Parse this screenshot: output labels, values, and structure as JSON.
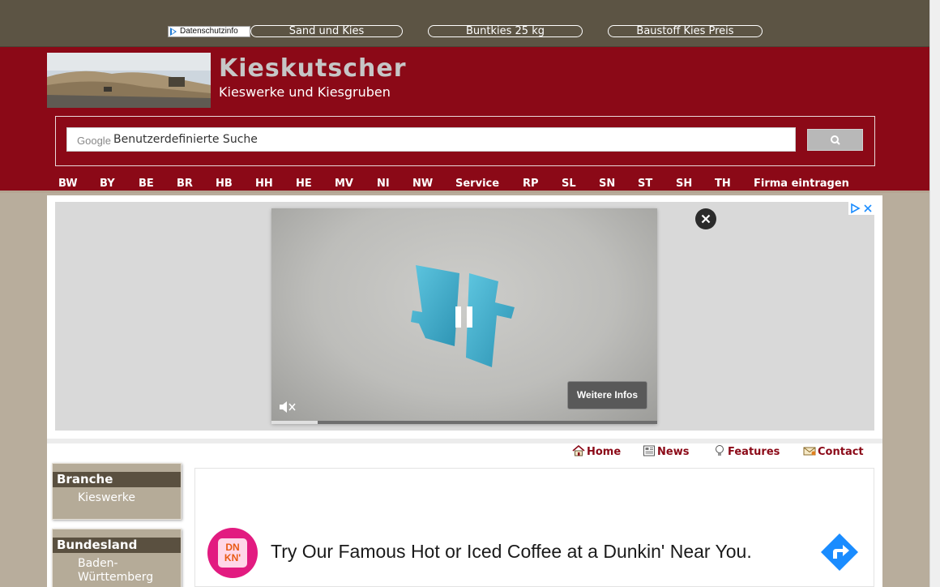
{
  "topbar": {
    "privacy_label": "Datenschutzinfo",
    "links": [
      "Sand und Kies",
      "Buntkies 25 kg",
      "Baustoff Kies Preis"
    ]
  },
  "header": {
    "title": "Kieskutscher",
    "subtitle": "Kieswerke und Kiesgruben"
  },
  "search": {
    "brand": "Google",
    "placeholder": "Benutzerdefinierte Suche"
  },
  "nav": [
    "BW",
    "BY",
    "BE",
    "BR",
    "HB",
    "HH",
    "HE",
    "MV",
    "NI",
    "NW",
    "Service",
    "RP",
    "SL",
    "SN",
    "ST",
    "SH",
    "TH",
    "Firma eintragen"
  ],
  "video_ad": {
    "more_info_label": "Weitere Infos",
    "progress_fraction": 0.12
  },
  "menu": {
    "home": "Home",
    "news": "News",
    "features": "Features",
    "contact": "Contact"
  },
  "sidebar": {
    "branche": {
      "title": "Branche",
      "items": [
        "Kieswerke"
      ]
    },
    "bundesland": {
      "title": "Bundesland",
      "items": [
        "Baden-Württemberg"
      ]
    }
  },
  "dunkin_ad": {
    "logo_text": "DN KN'",
    "headline": "Try Our Famous Hot or Iced Coffee at a Dunkin' Near You."
  },
  "colors": {
    "topbar": "#5c5444",
    "header": "#8b0917",
    "sidebar_head": "#5a5040",
    "accent_red": "#8b0917",
    "dunkin_pink": "#e21b80",
    "dunkin_orange": "#e85a14",
    "ad_blue": "#1a8cff"
  }
}
